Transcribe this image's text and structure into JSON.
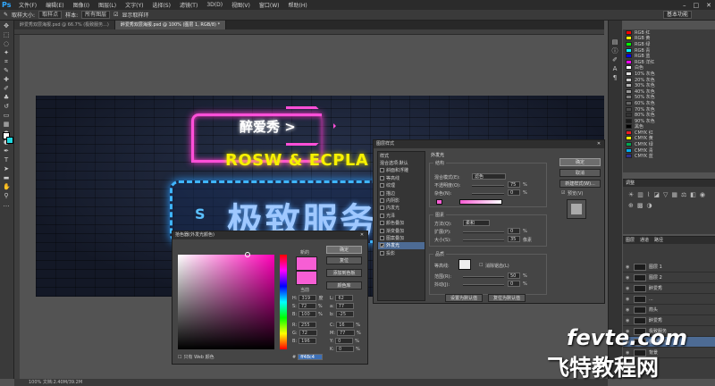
{
  "menubar": {
    "logo": "Ps",
    "items": [
      "文件(F)",
      "编辑(E)",
      "图像(I)",
      "图层(L)",
      "文字(Y)",
      "选择(S)",
      "滤镜(T)",
      "3D(D)",
      "视图(V)",
      "窗口(W)",
      "帮助(H)"
    ],
    "min": "–",
    "max": "□",
    "close": "✕"
  },
  "optbar": {
    "tool_label": "取样大小:",
    "tool_value": "取样点",
    "sample_label": "样本:",
    "sample_value": "所有图层",
    "ring_label": "显示取样环",
    "workspace": "基本功能"
  },
  "tabs": [
    {
      "label": "醉爱秀双层海报.psd @ 66.7% (极致服务...)"
    },
    {
      "label": "醉爱秀双层海报.psd @ 100% (图层 1, RGB/8) *"
    }
  ],
  "swatches": [
    {
      "name": "RGB 红",
      "color": "#ff0000"
    },
    {
      "name": "RGB 黄",
      "color": "#ffff00"
    },
    {
      "name": "RGB 绿",
      "color": "#00ff00"
    },
    {
      "name": "RGB 青",
      "color": "#00ffff"
    },
    {
      "name": "RGB 蓝",
      "color": "#0000ff"
    },
    {
      "name": "RGB 洋红",
      "color": "#ff00ff"
    },
    {
      "name": "白色",
      "color": "#ffffff"
    },
    {
      "name": "10% 灰色",
      "color": "#e6e6e6"
    },
    {
      "name": "20% 灰色",
      "color": "#cccccc"
    },
    {
      "name": "30% 灰色",
      "color": "#b3b3b3"
    },
    {
      "name": "40% 灰色",
      "color": "#999999"
    },
    {
      "name": "50% 灰色",
      "color": "#808080"
    },
    {
      "name": "60% 灰色",
      "color": "#666666"
    },
    {
      "name": "70% 灰色",
      "color": "#4d4d4d"
    },
    {
      "name": "80% 灰色",
      "color": "#333333"
    },
    {
      "name": "90% 灰色",
      "color": "#1a1a1a"
    },
    {
      "name": "黑色",
      "color": "#000000"
    },
    {
      "name": "CMYK 红",
      "color": "#ed1c24"
    },
    {
      "name": "CMYK 黄",
      "color": "#fff200"
    },
    {
      "name": "CMYK 绿",
      "color": "#00a651"
    },
    {
      "name": "CMYK 青",
      "color": "#00aeef"
    },
    {
      "name": "CMYK 蓝",
      "color": "#2e3192"
    }
  ],
  "adjust_title": "调整",
  "layers": {
    "tabs": [
      "图层",
      "通道",
      "路径"
    ],
    "items": [
      {
        "name": "图层 1",
        "selected": false
      },
      {
        "name": "图层 2",
        "selected": false
      },
      {
        "name": "醉爱秀",
        "selected": false
      },
      {
        "name": "...",
        "selected": false
      },
      {
        "name": "箭头",
        "selected": false
      },
      {
        "name": "醉爱秀",
        "selected": false
      },
      {
        "name": "极致服务",
        "selected": false
      },
      {
        "name": "极致服务",
        "selected": true
      },
      {
        "name": "背景",
        "selected": false
      }
    ]
  },
  "canvas": {
    "text1": "醉爱秀 >",
    "text2": "ROSW & ECPLA",
    "text3": "极致服务",
    "s_logo": "S"
  },
  "layer_style": {
    "title": "图层样式",
    "list": [
      {
        "label": "样式",
        "head": true
      },
      {
        "label": "混合选项:默认",
        "head": true
      },
      {
        "label": "斜面和浮雕"
      },
      {
        "label": "等高线"
      },
      {
        "label": "纹理"
      },
      {
        "label": "描边"
      },
      {
        "label": "内阴影"
      },
      {
        "label": "内发光"
      },
      {
        "label": "光泽"
      },
      {
        "label": "颜色叠加"
      },
      {
        "label": "渐变叠加"
      },
      {
        "label": "图案叠加"
      },
      {
        "label": "外发光",
        "on": true
      },
      {
        "label": "投影"
      }
    ],
    "section": "外发光",
    "struct": "结构",
    "blend_mode_label": "混合模式(E):",
    "blend_mode": "滤色",
    "opacity_label": "不透明度(O):",
    "opacity": "75",
    "noise_label": "杂色(N):",
    "noise": "0",
    "pct": "%",
    "elements": "图素",
    "method_label": "方法(Q):",
    "method": "柔和",
    "spread_label": "扩展(P):",
    "spread": "0",
    "size_label": "大小(S):",
    "size": "35",
    "px": "像素",
    "quality": "品质",
    "contour_label": "等高线:",
    "aa_label": "消除锯齿(L)",
    "range_label": "范围(R):",
    "range": "50",
    "jitter_label": "抖动(J):",
    "jitter": "0",
    "set_default": "设置为默认值",
    "reset_default": "复位为默认值",
    "ok": "确定",
    "cancel": "取消",
    "new_style": "新建样式(W)...",
    "preview": "预览(V)"
  },
  "color_picker": {
    "title": "拾色器(外发光颜色)",
    "new_label": "新的",
    "cur_label": "当前",
    "ok": "确定",
    "cancel": "复位",
    "add": "添加到色板",
    "lib": "颜色库",
    "web_only": "只有 Web 颜色",
    "H": "319",
    "S": "72",
    "B": "100",
    "R": "255",
    "G": "72",
    "Bv": "196",
    "L": "62",
    "a": "77",
    "b": "-25",
    "C": "16",
    "M": "77",
    "Y": "0",
    "K": "0",
    "hex": "ff48c4",
    "deg": "度",
    "pct": "%"
  },
  "status": "100%  文档:2.40M/39.2M",
  "watermark": {
    "en": "fevte.com",
    "cn": "飞特教程网"
  }
}
